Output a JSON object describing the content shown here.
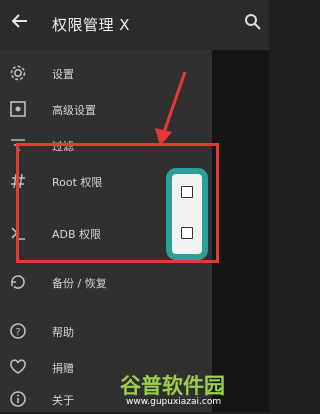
{
  "app": {
    "title": "权限管理 X"
  },
  "menu": [
    {
      "label": "设置",
      "icon": "gear-icon"
    },
    {
      "label": "高级设置",
      "icon": "advanced-settings-icon"
    },
    {
      "label": "过滤",
      "icon": "filter-icon"
    },
    {
      "label": "Root 权限",
      "icon": "hash-icon",
      "checked": false
    },
    {
      "label": "ADB 权限",
      "icon": "terminal-icon",
      "checked": false
    },
    {
      "label": "备份 / 恢复",
      "icon": "backup-icon"
    },
    {
      "label": "帮助",
      "icon": "help-icon"
    },
    {
      "label": "捐赠",
      "icon": "heart-icon"
    },
    {
      "label": "关于",
      "icon": "info-icon"
    }
  ],
  "colors": {
    "accent_red": "#e53935",
    "highlight_teal": "#2aa198",
    "watermark_green": "#9ccf4a"
  },
  "watermark": {
    "text": "谷普软件园",
    "url": "www.gupuxiazai.com"
  }
}
